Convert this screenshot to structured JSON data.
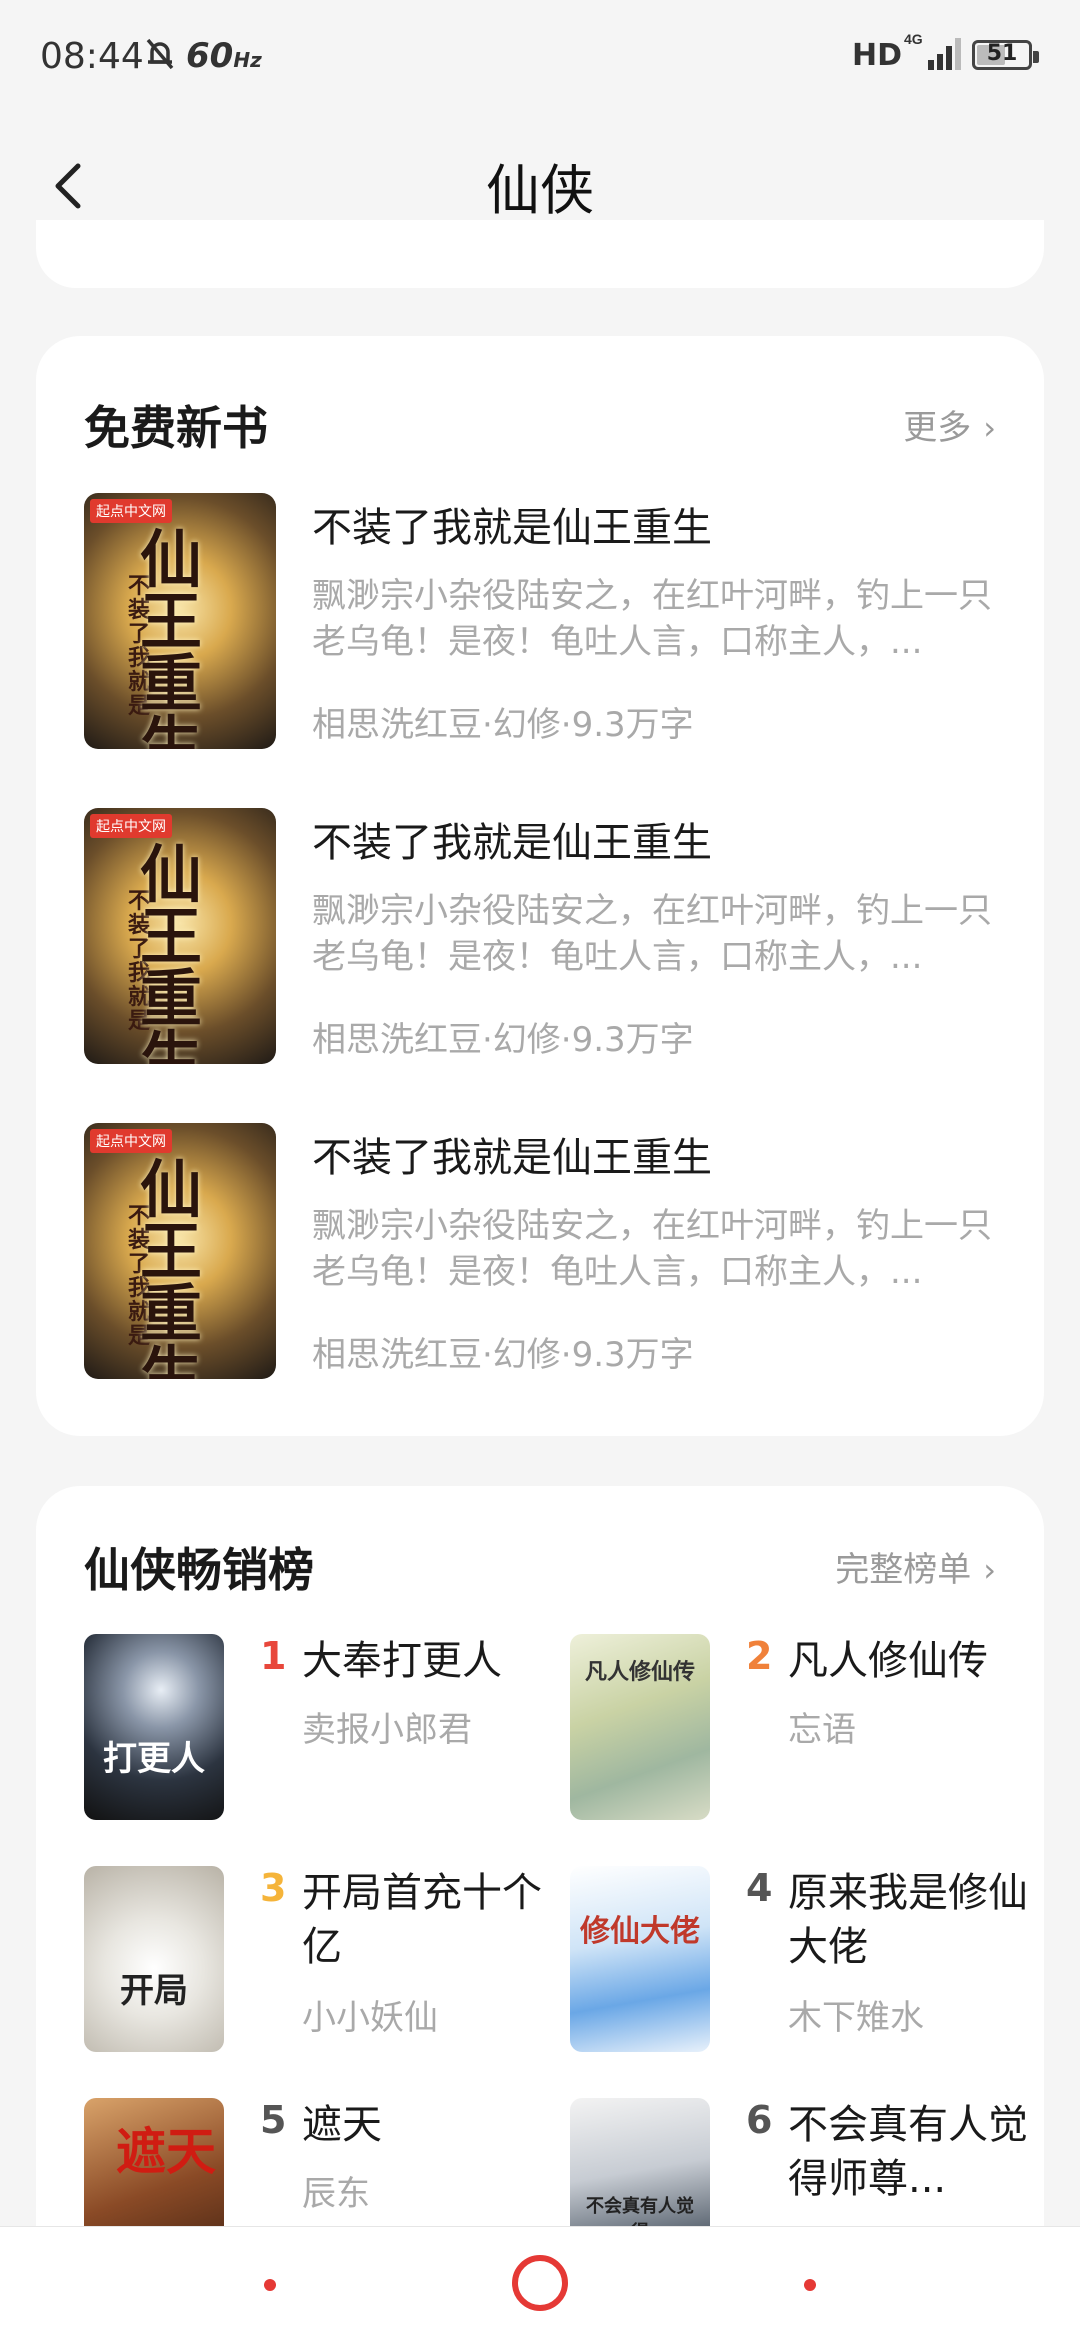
{
  "status_bar": {
    "time": "08:44",
    "refresh_rate": "60",
    "refresh_unit": "Hz",
    "hd": "HD",
    "network": "4G",
    "battery": "51"
  },
  "header": {
    "title": "仙侠",
    "back_icon": "chevron-left-icon"
  },
  "free_new_books": {
    "title": "免费新书",
    "more_label": "更多",
    "books": [
      {
        "title": "不装了我就是仙王重生",
        "description": "飘渺宗小杂役陆安之，在红叶河畔，钓上一只老乌龟！是夜！龟吐人言，口称主人，...",
        "meta": "相思洗红豆·幻修·9.3万字",
        "cover_badge": "起点中文网",
        "cover_text": "仙王重生",
        "cover_subtext": "不装了我就是"
      },
      {
        "title": "不装了我就是仙王重生",
        "description": "飘渺宗小杂役陆安之，在红叶河畔，钓上一只老乌龟！是夜！龟吐人言，口称主人，...",
        "meta": "相思洗红豆·幻修·9.3万字",
        "cover_badge": "起点中文网",
        "cover_text": "仙王重生",
        "cover_subtext": "不装了我就是"
      },
      {
        "title": "不装了我就是仙王重生",
        "description": "飘渺宗小杂役陆安之，在红叶河畔，钓上一只老乌龟！是夜！龟吐人言，口称主人，...",
        "meta": "相思洗红豆·幻修·9.3万字",
        "cover_badge": "起点中文网",
        "cover_text": "仙王重生",
        "cover_subtext": "不装了我就是"
      }
    ]
  },
  "bestseller": {
    "title": "仙侠畅销榜",
    "more_label": "完整榜单",
    "items": [
      {
        "rank": "1",
        "title": "大奉打更人",
        "author": "卖报小郎君",
        "rank_color": "#e8473b",
        "cover_text": "打更人"
      },
      {
        "rank": "2",
        "title": "凡人修仙传",
        "author": "忘语",
        "rank_color": "#f0813a",
        "cover_text": "凡人修仙传"
      },
      {
        "rank": "3",
        "title": "开局首充十个亿",
        "author": "小小妖仙",
        "rank_color": "#f5b43a",
        "cover_text": "开局"
      },
      {
        "rank": "4",
        "title": "原来我是修仙大佬",
        "author": "木下雉水",
        "rank_color": "#555555",
        "cover_text": "修仙大佬"
      },
      {
        "rank": "5",
        "title": "遮天",
        "author": "辰东",
        "rank_color": "#555555",
        "cover_text": "遮天"
      },
      {
        "rank": "6",
        "title": "不会真有人觉得师尊...",
        "author": "",
        "rank_color": "#555555",
        "cover_text": "不会真有人觉得"
      }
    ]
  },
  "nav": {
    "left": "nav-dot",
    "home": "home-circle-icon",
    "right": "nav-dot"
  }
}
